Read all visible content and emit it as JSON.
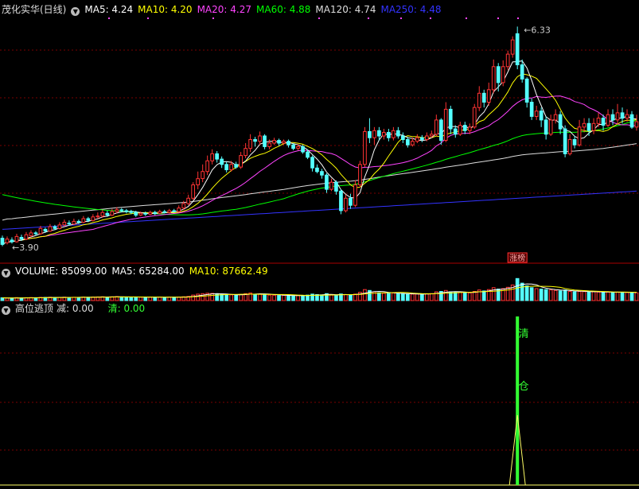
{
  "stock": {
    "title": "茂化实华(日线)"
  },
  "price_panel": {
    "indicators": [
      {
        "label": "MA5: 4.24",
        "color": "#ffffff"
      },
      {
        "label": "MA10: 4.20",
        "color": "#ffff00"
      },
      {
        "label": "MA20: 4.27",
        "color": "#ff44ff"
      },
      {
        "label": "MA60: 4.88",
        "color": "#00ff00"
      },
      {
        "label": "MA120: 4.74",
        "color": "#dddddd"
      },
      {
        "label": "MA250: 4.48",
        "color": "#3333ff"
      }
    ],
    "high_label": "6.33",
    "low_label": "3.90",
    "badge": "涨榜"
  },
  "volume_panel": {
    "indicators": [
      {
        "label": "VOLUME: 85099.00",
        "color": "#ffffff"
      },
      {
        "label": "MA5: 65284.00",
        "color": "#ffffff"
      },
      {
        "label": "MA10: 87662.49",
        "color": "#ffff00"
      }
    ]
  },
  "signal_panel": {
    "title": "高位逃顶",
    "reduce_label": "减: 0.00",
    "clear_label": "清: 0.00",
    "signal_chars": [
      "清",
      "仓"
    ]
  },
  "colors": {
    "up": "#ff3333",
    "down": "#54ffff",
    "grid": "#7a0000",
    "border": "#aa0000",
    "signal": "#33ff33",
    "signal_peak": "#ffff66"
  },
  "chart_data": {
    "type": "candlestick",
    "ylim": [
      3.75,
      6.45
    ],
    "high": 6.33,
    "low": 3.9,
    "signal_index": 108,
    "candles": [
      [
        3.95,
        3.88,
        3.98,
        3.86
      ],
      [
        3.9,
        3.94,
        3.97,
        3.88
      ],
      [
        3.93,
        3.91,
        3.96,
        3.89
      ],
      [
        3.91,
        3.97,
        4.0,
        3.9
      ],
      [
        3.96,
        3.94,
        3.99,
        3.92
      ],
      [
        3.94,
        3.99,
        4.02,
        3.93
      ],
      [
        3.98,
        4.01,
        4.04,
        3.96
      ],
      [
        4.01,
        4.0,
        4.03,
        3.98
      ],
      [
        4.0,
        4.06,
        4.09,
        3.99
      ],
      [
        4.05,
        4.03,
        4.07,
        4.01
      ],
      [
        4.03,
        4.08,
        4.11,
        4.02
      ],
      [
        4.08,
        4.06,
        4.1,
        4.04
      ],
      [
        4.06,
        4.1,
        4.13,
        4.05
      ],
      [
        4.1,
        4.13,
        4.16,
        4.08
      ],
      [
        4.12,
        4.11,
        4.15,
        4.09
      ],
      [
        4.11,
        4.14,
        4.17,
        4.1
      ],
      [
        4.14,
        4.13,
        4.16,
        4.11
      ],
      [
        4.13,
        4.17,
        4.2,
        4.12
      ],
      [
        4.17,
        4.15,
        4.19,
        4.13
      ],
      [
        4.15,
        4.19,
        4.22,
        4.14
      ],
      [
        4.19,
        4.2,
        4.24,
        4.17
      ],
      [
        4.2,
        4.24,
        4.27,
        4.18
      ],
      [
        4.23,
        4.21,
        4.26,
        4.19
      ],
      [
        4.21,
        4.25,
        4.28,
        4.2
      ],
      [
        4.25,
        4.27,
        4.3,
        4.23
      ],
      [
        4.27,
        4.26,
        4.29,
        4.24
      ],
      [
        4.26,
        4.25,
        4.28,
        4.23
      ],
      [
        4.25,
        4.24,
        4.27,
        4.22
      ],
      [
        4.24,
        4.21,
        4.26,
        4.19
      ],
      [
        4.21,
        4.23,
        4.25,
        4.2
      ],
      [
        4.23,
        4.22,
        4.25,
        4.2
      ],
      [
        4.22,
        4.24,
        4.26,
        4.21
      ],
      [
        4.24,
        4.23,
        4.26,
        4.21
      ],
      [
        4.23,
        4.25,
        4.27,
        4.22
      ],
      [
        4.25,
        4.24,
        4.27,
        4.23
      ],
      [
        4.24,
        4.26,
        4.28,
        4.23
      ],
      [
        4.26,
        4.25,
        4.28,
        4.24
      ],
      [
        4.25,
        4.29,
        4.32,
        4.24
      ],
      [
        4.29,
        4.34,
        4.37,
        4.27
      ],
      [
        4.34,
        4.4,
        4.44,
        4.32
      ],
      [
        4.4,
        4.55,
        4.58,
        4.38
      ],
      [
        4.55,
        4.62,
        4.7,
        4.5
      ],
      [
        4.62,
        4.7,
        4.78,
        4.58
      ],
      [
        4.7,
        4.82,
        4.88,
        4.66
      ],
      [
        4.82,
        4.9,
        4.95,
        4.78
      ],
      [
        4.9,
        4.84,
        4.93,
        4.8
      ],
      [
        4.84,
        4.78,
        4.87,
        4.74
      ],
      [
        4.78,
        4.72,
        4.81,
        4.69
      ],
      [
        4.72,
        4.78,
        4.82,
        4.7
      ],
      [
        4.78,
        4.75,
        4.81,
        4.73
      ],
      [
        4.75,
        4.88,
        4.92,
        4.73
      ],
      [
        4.88,
        4.96,
        5.02,
        4.85
      ],
      [
        4.96,
        5.06,
        5.12,
        4.92
      ],
      [
        5.06,
        5.04,
        5.09,
        4.98
      ],
      [
        5.04,
        5.1,
        5.15,
        5.0
      ],
      [
        5.1,
        4.98,
        5.12,
        4.95
      ],
      [
        4.98,
        5.02,
        5.06,
        4.95
      ],
      [
        5.02,
        5.05,
        5.08,
        5.0
      ],
      [
        5.05,
        5.02,
        5.07,
        4.99
      ],
      [
        5.02,
        5.04,
        5.06,
        5.0
      ],
      [
        5.04,
        5.0,
        5.06,
        4.97
      ],
      [
        5.0,
        4.96,
        5.02,
        4.94
      ],
      [
        4.96,
        4.98,
        5.01,
        4.94
      ],
      [
        4.98,
        4.92,
        5.0,
        4.9
      ],
      [
        4.92,
        4.86,
        4.95,
        4.84
      ],
      [
        4.86,
        4.74,
        4.88,
        4.7
      ],
      [
        4.74,
        4.7,
        4.78,
        4.68
      ],
      [
        4.7,
        4.66,
        4.73,
        4.62
      ],
      [
        4.66,
        4.5,
        4.68,
        4.46
      ],
      [
        4.5,
        4.58,
        4.62,
        4.48
      ],
      [
        4.58,
        4.48,
        4.6,
        4.44
      ],
      [
        4.48,
        4.26,
        4.5,
        4.22
      ],
      [
        4.26,
        4.4,
        4.44,
        4.24
      ],
      [
        4.4,
        4.32,
        4.45,
        4.28
      ],
      [
        4.32,
        4.55,
        4.6,
        4.3
      ],
      [
        4.55,
        4.78,
        4.82,
        4.52
      ],
      [
        4.78,
        5.15,
        5.2,
        4.75
      ],
      [
        5.15,
        5.08,
        5.3,
        5.02
      ],
      [
        5.08,
        5.16,
        5.2,
        5.0
      ],
      [
        5.16,
        5.1,
        5.2,
        5.05
      ],
      [
        5.1,
        5.14,
        5.18,
        5.06
      ],
      [
        5.14,
        5.08,
        5.18,
        5.04
      ],
      [
        5.08,
        5.16,
        5.2,
        5.05
      ],
      [
        5.16,
        5.1,
        5.2,
        5.07
      ],
      [
        5.1,
        5.06,
        5.14,
        5.02
      ],
      [
        5.06,
        5.0,
        5.09,
        4.97
      ],
      [
        5.0,
        5.04,
        5.08,
        4.98
      ],
      [
        5.04,
        5.08,
        5.12,
        5.02
      ],
      [
        5.08,
        5.06,
        5.11,
        5.03
      ],
      [
        5.06,
        5.1,
        5.14,
        5.04
      ],
      [
        5.1,
        5.12,
        5.16,
        5.08
      ],
      [
        5.12,
        5.28,
        5.34,
        5.1
      ],
      [
        5.28,
        5.05,
        5.3,
        5.0
      ],
      [
        5.05,
        5.4,
        5.48,
        5.03
      ],
      [
        5.4,
        5.18,
        5.44,
        5.12
      ],
      [
        5.18,
        5.12,
        5.22,
        5.08
      ],
      [
        5.12,
        5.22,
        5.26,
        5.1
      ],
      [
        5.22,
        5.16,
        5.26,
        5.12
      ],
      [
        5.16,
        5.2,
        5.24,
        5.12
      ],
      [
        5.2,
        5.42,
        5.46,
        5.18
      ],
      [
        5.42,
        5.58,
        5.66,
        5.38
      ],
      [
        5.58,
        5.48,
        5.62,
        5.42
      ],
      [
        5.48,
        5.62,
        5.7,
        5.44
      ],
      [
        5.62,
        5.88,
        5.96,
        5.58
      ],
      [
        5.88,
        5.7,
        5.92,
        5.6
      ],
      [
        5.7,
        5.88,
        5.95,
        5.66
      ],
      [
        5.88,
        6.02,
        6.06,
        5.84
      ],
      [
        6.02,
        6.18,
        6.22,
        5.98
      ],
      [
        6.25,
        5.9,
        6.33,
        5.85
      ],
      [
        5.9,
        5.74,
        5.96,
        5.7
      ],
      [
        5.74,
        5.48,
        5.76,
        5.42
      ],
      [
        5.48,
        5.32,
        5.52,
        5.28
      ],
      [
        5.32,
        5.38,
        5.44,
        5.28
      ],
      [
        5.38,
        5.28,
        5.42,
        5.2
      ],
      [
        5.28,
        5.12,
        5.32,
        5.06
      ],
      [
        5.12,
        5.28,
        5.34,
        5.1
      ],
      [
        5.28,
        5.34,
        5.4,
        5.24
      ],
      [
        5.34,
        5.18,
        5.38,
        5.12
      ],
      [
        5.18,
        4.9,
        5.22,
        4.86
      ],
      [
        4.9,
        5.06,
        5.12,
        4.88
      ],
      [
        5.06,
        5.0,
        5.1,
        4.96
      ],
      [
        5.0,
        5.2,
        5.28,
        4.98
      ],
      [
        5.2,
        5.24,
        5.3,
        5.14
      ],
      [
        5.24,
        5.16,
        5.3,
        5.1
      ],
      [
        5.16,
        5.24,
        5.3,
        5.12
      ],
      [
        5.24,
        5.3,
        5.36,
        5.2
      ],
      [
        5.3,
        5.22,
        5.34,
        5.16
      ],
      [
        5.22,
        5.34,
        5.4,
        5.2
      ],
      [
        5.34,
        5.28,
        5.4,
        5.22
      ],
      [
        5.28,
        5.36,
        5.46,
        5.24
      ],
      [
        5.36,
        5.3,
        5.42,
        5.24
      ],
      [
        5.3,
        5.34,
        5.4,
        5.26
      ],
      [
        5.34,
        5.2,
        5.38,
        5.18
      ],
      [
        5.2,
        5.26,
        5.34,
        5.16
      ]
    ],
    "volume_max": 260000,
    "volumes": [
      30000,
      28000,
      26000,
      32000,
      29000,
      31000,
      33000,
      30000,
      35000,
      34000,
      36000,
      33000,
      35000,
      37000,
      34000,
      36000,
      35000,
      38000,
      36000,
      39000,
      40000,
      42000,
      38000,
      41000,
      43000,
      40000,
      38000,
      37000,
      39000,
      36000,
      35000,
      37000,
      36000,
      38000,
      35000,
      37000,
      36000,
      39000,
      42000,
      45000,
      60000,
      70000,
      75000,
      80000,
      78000,
      72000,
      65000,
      60000,
      62000,
      58000,
      68000,
      75000,
      82000,
      70000,
      72000,
      65000,
      60000,
      58000,
      55000,
      57000,
      54000,
      52000,
      55000,
      50000,
      60000,
      70000,
      65000,
      62000,
      75000,
      60000,
      58000,
      72000,
      65000,
      60000,
      70000,
      90000,
      120000,
      110000,
      95000,
      85000,
      80000,
      78000,
      82000,
      76000,
      72000,
      68000,
      70000,
      73000,
      70000,
      74000,
      76000,
      95000,
      100000,
      110000,
      95000,
      88000,
      90000,
      86000,
      84000,
      100000,
      115000,
      105000,
      120000,
      140000,
      125000,
      130000,
      145000,
      170000,
      240000,
      190000,
      160000,
      140000,
      130000,
      125000,
      120000,
      115000,
      110000,
      105000,
      115000,
      100000,
      95000,
      100000,
      98000,
      94000,
      96000,
      92000,
      90000,
      94000,
      88000,
      92000,
      90000,
      88000,
      86000,
      85099
    ]
  }
}
